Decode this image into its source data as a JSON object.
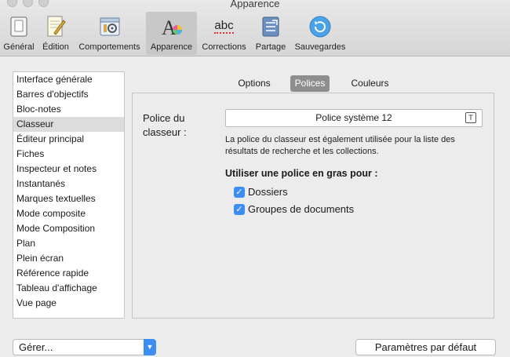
{
  "window": {
    "title": "Apparence"
  },
  "toolbar": {
    "items": [
      {
        "label": "Général",
        "icon": "general-icon"
      },
      {
        "label": "Édition",
        "icon": "edition-icon"
      },
      {
        "label": "Comportements",
        "icon": "behaviors-icon"
      },
      {
        "label": "Apparence",
        "icon": "appearance-icon",
        "active": true
      },
      {
        "label": "Corrections",
        "icon": "corrections-icon"
      },
      {
        "label": "Partage",
        "icon": "sharing-icon"
      },
      {
        "label": "Sauvegardes",
        "icon": "backup-icon"
      }
    ],
    "corrections_icon_text": "abc"
  },
  "sidebar": {
    "items": [
      "Interface générale",
      "Barres d'objectifs",
      "Bloc-notes",
      "Classeur",
      "Éditeur principal",
      "Fiches",
      "Inspecteur et notes",
      "Instantanés",
      "Marques textuelles",
      "Mode composite",
      "Mode Composition",
      "Plan",
      "Plein écran",
      "Référence rapide",
      "Tableau d'affichage",
      "Vue page"
    ],
    "selected": "Classeur"
  },
  "tabs": [
    {
      "label": "Options"
    },
    {
      "label": "Polices",
      "active": true
    },
    {
      "label": "Couleurs"
    }
  ],
  "main": {
    "font_label": "Police du classeur :",
    "font_value": "Police système 12",
    "font_picker_glyph": "T",
    "help_text": "La police du classeur est également utilisée pour la liste des résultats de recherche et les collections.",
    "bold_label": "Utiliser une police en gras pour :",
    "checkboxes": [
      {
        "label": "Dossiers",
        "checked": true
      },
      {
        "label": "Groupes de documents",
        "checked": true
      }
    ]
  },
  "bottom": {
    "manage_label": "Gérer...",
    "defaults_label": "Paramètres par défaut"
  },
  "colors": {
    "accent": "#3d8ef2",
    "selected_tab": "#8e8e8e",
    "selected_row": "#dcdcdc"
  }
}
